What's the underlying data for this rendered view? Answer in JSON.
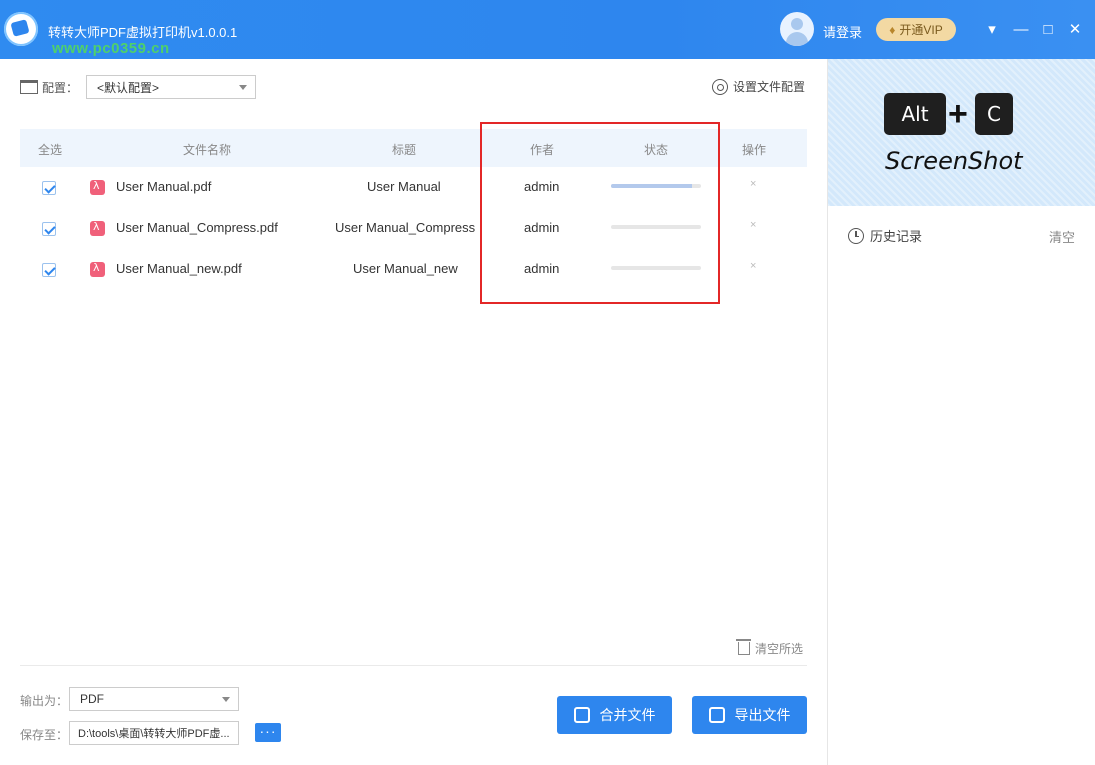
{
  "window": {
    "title": "转转大师PDF虚拟打印机v1.0.0.1",
    "watermark": "www.pc0359.cn",
    "login_label": "请登录",
    "vip_label": "开通VIP",
    "controls": {
      "menu": "▾",
      "minimize": "—",
      "maximize": "□",
      "close": "✕"
    }
  },
  "config": {
    "label": "配置：",
    "selected": "<默认配置>",
    "settings_link": "设置文件配置"
  },
  "table": {
    "headers": {
      "select_all": "全选",
      "filename": "文件名称",
      "title": "标题",
      "author": "作者",
      "status": "状态",
      "action": "操作"
    },
    "rows": [
      {
        "checked": true,
        "filename": "User Manual.pdf",
        "title": "User Manual",
        "author": "admin",
        "progress": 0.9,
        "delete": "×"
      },
      {
        "checked": true,
        "filename": "User Manual_Compress.pdf",
        "title": "User Manual_Compress",
        "author": "admin",
        "progress": 0.0,
        "delete": "×"
      },
      {
        "checked": true,
        "filename": "User Manual_new.pdf",
        "title": "User Manual_new",
        "author": "admin",
        "progress": 0.0,
        "delete": "×"
      }
    ],
    "clear_selected": "清空所选"
  },
  "output": {
    "format_label": "输出为：",
    "format_value": "PDF",
    "save_label": "保存至：",
    "save_path": "D:\\tools\\桌面\\转转大师PDF虚...",
    "browse_label": "···",
    "merge_button": "合并文件",
    "export_button": "导出文件"
  },
  "sidebar": {
    "banner_key1": "Alt",
    "banner_plus": "+",
    "banner_key2": "C",
    "banner_caption": "ScreenShot",
    "history_label": "历史记录",
    "clear_label": "清空"
  },
  "colors": {
    "accent": "#2e86ee",
    "highlight": "#e32727",
    "vip_bg": "#f3d9a3",
    "pdf_icon": "#f0607a"
  }
}
